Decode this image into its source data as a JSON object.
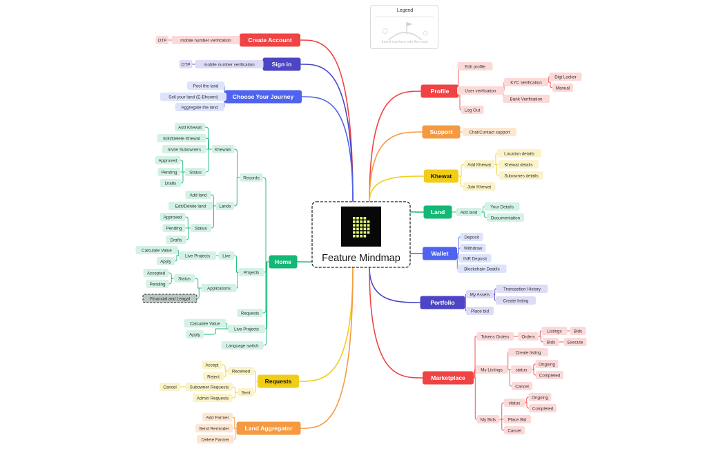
{
  "legend": {
    "title": "Legend",
    "hint": "Insert markers into the topic"
  },
  "center": {
    "title": "Feature Mindmap",
    "logo": "dotted-grid-logo"
  },
  "colors": {
    "red": "#f04343",
    "red_chip": "#fcd9d9",
    "navy": "#4c45c4",
    "navy_chip": "#dcdcf7",
    "blue": "#4f63ef",
    "blue_chip": "#dde3fb",
    "green": "#14b776",
    "green_chip": "#d3f2e5",
    "orange": "#f59a42",
    "orange_chip": "#fde7d2",
    "yellow": "#f2cd18",
    "yellow_chip": "#fbf3c7",
    "logo_bg": "#080808",
    "logo_dot": "#e8ff7a",
    "selected_bg": "#bcc7c2",
    "text": "#333333"
  },
  "topics": {
    "create_account": {
      "label": "Create Account",
      "children": {
        "mobile": "mobile number verification",
        "otp": "OTP"
      }
    },
    "sign_in": {
      "label": "Sign in",
      "children": {
        "mobile": "mobile number verification",
        "otp": "OTP"
      }
    },
    "journey": {
      "label": "Choose Your Journey",
      "children": {
        "pool": "Pool the land",
        "sell": "Sell your land (E-Bhoomi)",
        "aggregate": "Aggregate the land"
      }
    },
    "home": {
      "label": "Home",
      "records": {
        "label": "Records",
        "khewats": {
          "label": "Khewats",
          "add": "Add Khewat",
          "edit": "Edit/Delete Khewat",
          "invite": "Invite Subowners",
          "status": {
            "label": "Status",
            "approved": "Approved",
            "pending": "Pending",
            "drafts": "Drafts"
          }
        },
        "lands": {
          "label": "Lands",
          "add": "Add land",
          "edit": "Edit/Delete land",
          "status": {
            "label": "Status",
            "approved": "Approved",
            "pending": "Pending",
            "drafts": "Drafts"
          }
        }
      },
      "projects": {
        "label": "Projects",
        "live": {
          "label": "Live",
          "live_projects": "Live Projects",
          "calc": "Calculate Value",
          "apply": "Apply"
        },
        "applications": {
          "label": "Applications",
          "status": "Status",
          "accepted": "Accepted",
          "pending": "Pending",
          "financial": "Financial and Leagal"
        }
      },
      "requests": "Requests",
      "live_projects": {
        "label": "Live Projects",
        "calc": "Calculate Value",
        "apply": "Apply"
      },
      "language": "Language switch"
    },
    "requests": {
      "label": "Requests",
      "received": {
        "label": "Received",
        "accept": "Accept",
        "reject": "Reject"
      },
      "sent": {
        "label": "Sent",
        "subowner": "Subowner Requests",
        "cancel": "Cancel",
        "admin": "Admin Requests"
      }
    },
    "aggregator": {
      "label": "Land Aggregator",
      "add": "Add Farmer",
      "remind": "Send Reminder",
      "delete": "Delete Farmer"
    },
    "profile": {
      "label": "Profile",
      "edit": "Edit profile",
      "verification": "User verification",
      "kyc": "KYC Verification",
      "digi": "Digi Locker",
      "manual": "Manual",
      "bank": "Bank Verification",
      "logout": "Log Out"
    },
    "support": {
      "label": "Support",
      "chat": "Chat/Contact support"
    },
    "khewat": {
      "label": "Khewat",
      "add": "Add Khewat",
      "location": "Location details",
      "details": "Khewat details",
      "subownes": "Subownes details",
      "join": "Join Khewat"
    },
    "land": {
      "label": "Land",
      "add": "Add land",
      "your": "Your Details",
      "docs": "Documentation"
    },
    "wallet": {
      "label": "Wallet",
      "deposit": "Deposit",
      "withdraw": "Withdraw",
      "inr": "INR Deposit",
      "blockchain": "Blockchain Deatils"
    },
    "portfolio": {
      "label": "Portfolio",
      "assets": "My Assets",
      "history": "Transaction History",
      "create": "Create listing",
      "bid": "Place bid"
    },
    "marketplace": {
      "label": "Marketplace",
      "tokens": {
        "label": "Tokens Orders",
        "orders": "Orders",
        "listings": "Listings",
        "bids": "Bids",
        "bids2": "Bids",
        "execute": "Execute"
      },
      "my_listings": {
        "label": "My Listings",
        "create": "Create listing",
        "status": "status",
        "ongoing": "Ongoing",
        "completed": "Completed",
        "cancel": "Cancel"
      },
      "my_bids": {
        "label": "My Bids",
        "status": "status",
        "ongoing": "Ongoing",
        "completed": "Completed",
        "place": "Place Bid",
        "cancel": "Cancel"
      }
    }
  }
}
